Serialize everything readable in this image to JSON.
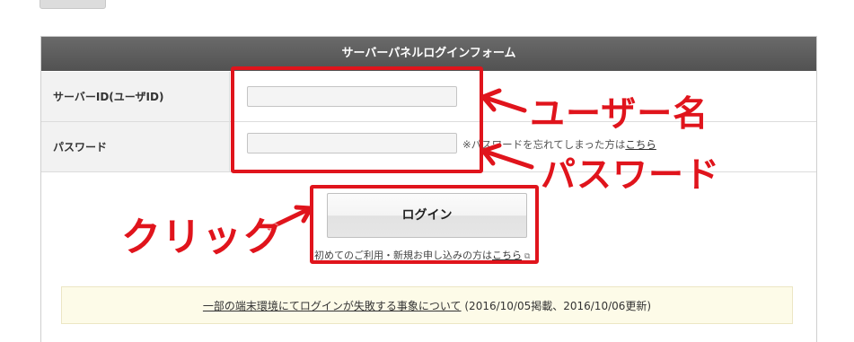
{
  "panel": {
    "title": "サーバーパネルログインフォーム",
    "fields": [
      {
        "label": "サーバーID(ユーザID)",
        "value": "",
        "placeholder": ""
      },
      {
        "label": "パスワード",
        "value": "",
        "placeholder": ""
      }
    ],
    "forgot_prefix": "※パスワードを忘れてしまった方は",
    "forgot_link": "こちら",
    "login_button": "ログイン",
    "signup_prefix": "初めてのご利用・新規お申し込みの方は",
    "signup_link": "こちら"
  },
  "notice": {
    "link": "一部の端末環境にてログインが失敗する事象について",
    "dates": " (2016/10/05掲載、2016/10/06更新)"
  },
  "annotations": {
    "username": "ユーザー名",
    "password": "パスワード",
    "click": "クリック",
    "color": "#e0141c"
  }
}
